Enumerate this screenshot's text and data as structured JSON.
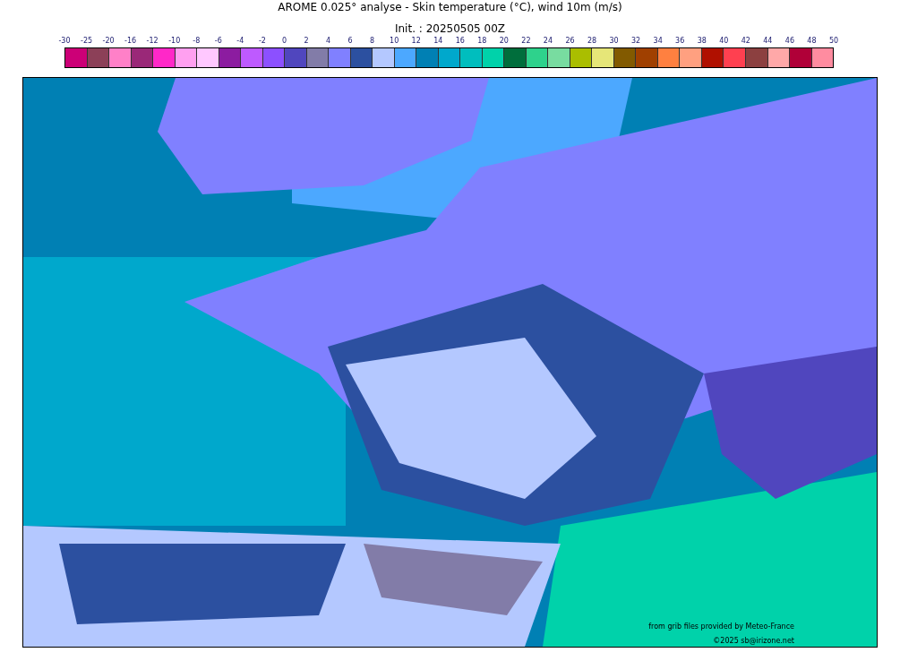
{
  "title": "AROME 0.025° analyse - Skin temperature (°C), wind 10m (m/s)",
  "subtitle": "Init. : 20250505 00Z",
  "colorbar": {
    "ticks": [
      "-30",
      "-25",
      "-20",
      "-16",
      "-12",
      "-10",
      "-8",
      "-6",
      "-4",
      "-2",
      "0",
      "2",
      "4",
      "6",
      "8",
      "10",
      "12",
      "14",
      "16",
      "18",
      "20",
      "22",
      "24",
      "26",
      "28",
      "30",
      "32",
      "34",
      "36",
      "38",
      "40",
      "42",
      "44",
      "46",
      "48",
      "50"
    ],
    "swatches": [
      {
        "color": "#cc0077"
      },
      {
        "color": "#8c4058"
      },
      {
        "color": "#ff80c8"
      },
      {
        "color": "#9a2878"
      },
      {
        "color": "#ff28c8"
      },
      {
        "color": "#ffa0f0"
      },
      {
        "color": "#ffc8ff"
      },
      {
        "color": "#8c1ca0"
      },
      {
        "color": "#be5aff"
      },
      {
        "color": "#8c50ff"
      },
      {
        "color": "#5046be"
      },
      {
        "color": "#827ca8"
      },
      {
        "color": "#8080ff"
      },
      {
        "color": "#2c50a0"
      },
      {
        "color": "#b4c8ff"
      },
      {
        "color": "#4ca8ff"
      },
      {
        "color": "#0080b4"
      },
      {
        "color": "#00a8cc"
      },
      {
        "color": "#00bebe"
      },
      {
        "color": "#00d2aa"
      },
      {
        "color": "#006e3c"
      },
      {
        "color": "#2ed28c"
      },
      {
        "color": "#78dca0"
      },
      {
        "color": "#aabe00"
      },
      {
        "color": "#e6e678"
      },
      {
        "color": "#825a00"
      },
      {
        "color": "#a04000"
      },
      {
        "color": "#ff8040"
      },
      {
        "color": "#ffa080"
      },
      {
        "color": "#b01000"
      },
      {
        "color": "#ff4050"
      },
      {
        "color": "#8c4040"
      },
      {
        "color": "#ffa8a8"
      },
      {
        "color": "#b00038"
      },
      {
        "color": "#ff8ca0"
      }
    ]
  },
  "credits": [
    "from grib files provided by Meteo-France",
    "©2025 sb@irizone.net"
  ]
}
